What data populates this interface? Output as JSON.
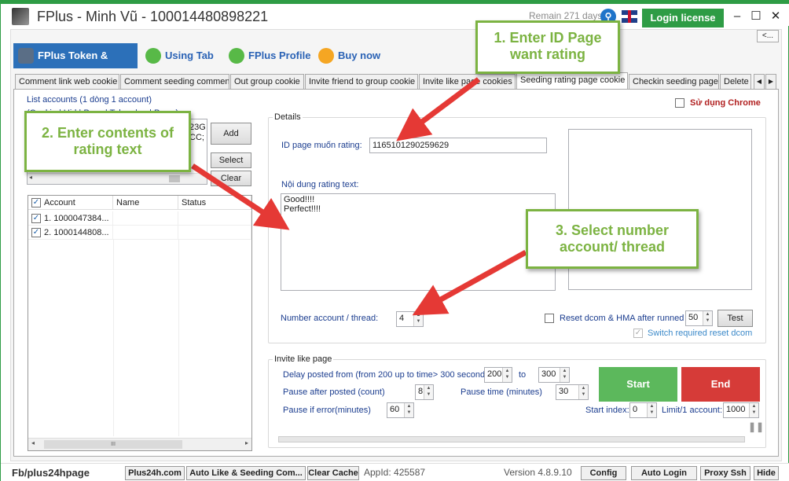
{
  "window": {
    "title": "FPlus - Minh Vũ - 100014480898221",
    "remain": "Remain 271 days",
    "login_button": "Login license",
    "minimize": "–",
    "maximize": "☐",
    "close": "✕",
    "back_button": "<..."
  },
  "main_tabs": [
    {
      "label": "FPlus Token & Cookie",
      "icon": "token-icon"
    },
    {
      "label": "Using Tab",
      "icon": "link-icon"
    },
    {
      "label": "FPlus Profile",
      "icon": "people-icon"
    },
    {
      "label": "Buy now",
      "icon": "cart-icon"
    }
  ],
  "sub_tabs": [
    "Comment link web cookie",
    "Comment seeding comment",
    "Out group cookie",
    "Invite friend to group cookie",
    "Invite like page cookies",
    "Seeding rating page cookie",
    "Checkin seeding page",
    "Delete"
  ],
  "left_panel": {
    "list_label": "List accounts (1 dòng 1 account)",
    "format_label": "(Cookie | Uid | Pass | Token | ... | Pass )",
    "textarea_line1": "23G",
    "textarea_line2": "CC;",
    "add_button": "Add",
    "select_button": "Select",
    "clear_button": "Clear",
    "grid_headers": [
      "Account",
      "Name",
      "Status"
    ],
    "rows": [
      {
        "account": "1. 1000047384...",
        "name": "",
        "status": "",
        "checked": true
      },
      {
        "account": "2. 1000144808...",
        "name": "",
        "status": "",
        "checked": true
      }
    ],
    "scroll_mid": "III"
  },
  "details": {
    "group_label": "Details",
    "use_chrome_label": "Sử dụng Chrome",
    "id_page_label": "ID page muốn rating:",
    "id_page_value": "1165101290259629",
    "rating_text_label": "Nội dung rating text:",
    "rating_lines": [
      "Good!!!!",
      "Perfect!!!!"
    ],
    "number_account_label": "Number account / thread:",
    "number_account_value": "4",
    "reset_dcom_label": "Reset dcom & HMA after runned",
    "reset_value": "50",
    "test_button": "Test",
    "switch_label": "Switch required reset dcom"
  },
  "invite": {
    "group_label": "Invite like page",
    "delay_label": "Delay posted from (from 200 up to time> 300 seconds)",
    "delay_from": "200",
    "to_label": "to",
    "delay_to": "300",
    "pause_after_label": "Pause after posted (count)",
    "pause_after_value": "8",
    "pause_time_label": "Pause time (minutes)",
    "pause_time_value": "30",
    "pause_error_label": "Pause if error(minutes)",
    "pause_error_value": "60",
    "start_index_label": "Start index:",
    "start_index_value": "0",
    "limit_label": "Limit/1 account:",
    "limit_value": "1000",
    "start_button": "Start",
    "end_button": "End"
  },
  "callouts": {
    "c1": "1. Enter ID Page want rating",
    "c2": "2. Enter contents of rating text",
    "c3": "3. Select number account/ thread"
  },
  "statusbar": {
    "page": "Fb/plus24hpage",
    "site_button": "Plus24h.com",
    "auto_like_button": "Auto Like & Seeding Com...",
    "clear_cache_button": "Clear Cache",
    "app_id": "AppId: 425587",
    "version": "Version 4.8.9.10",
    "config_button": "Config",
    "auto_login_button": "Auto Login",
    "proxy_button": "Proxy Ssh",
    "hide_button": "Hide"
  },
  "colors": {
    "accent_green": "#2e9c45",
    "callout_green": "#7cb342",
    "tab_blue": "#2c70b9",
    "arrow_red": "#e53935",
    "start_green": "#5cb85c",
    "end_red": "#d63b38"
  }
}
